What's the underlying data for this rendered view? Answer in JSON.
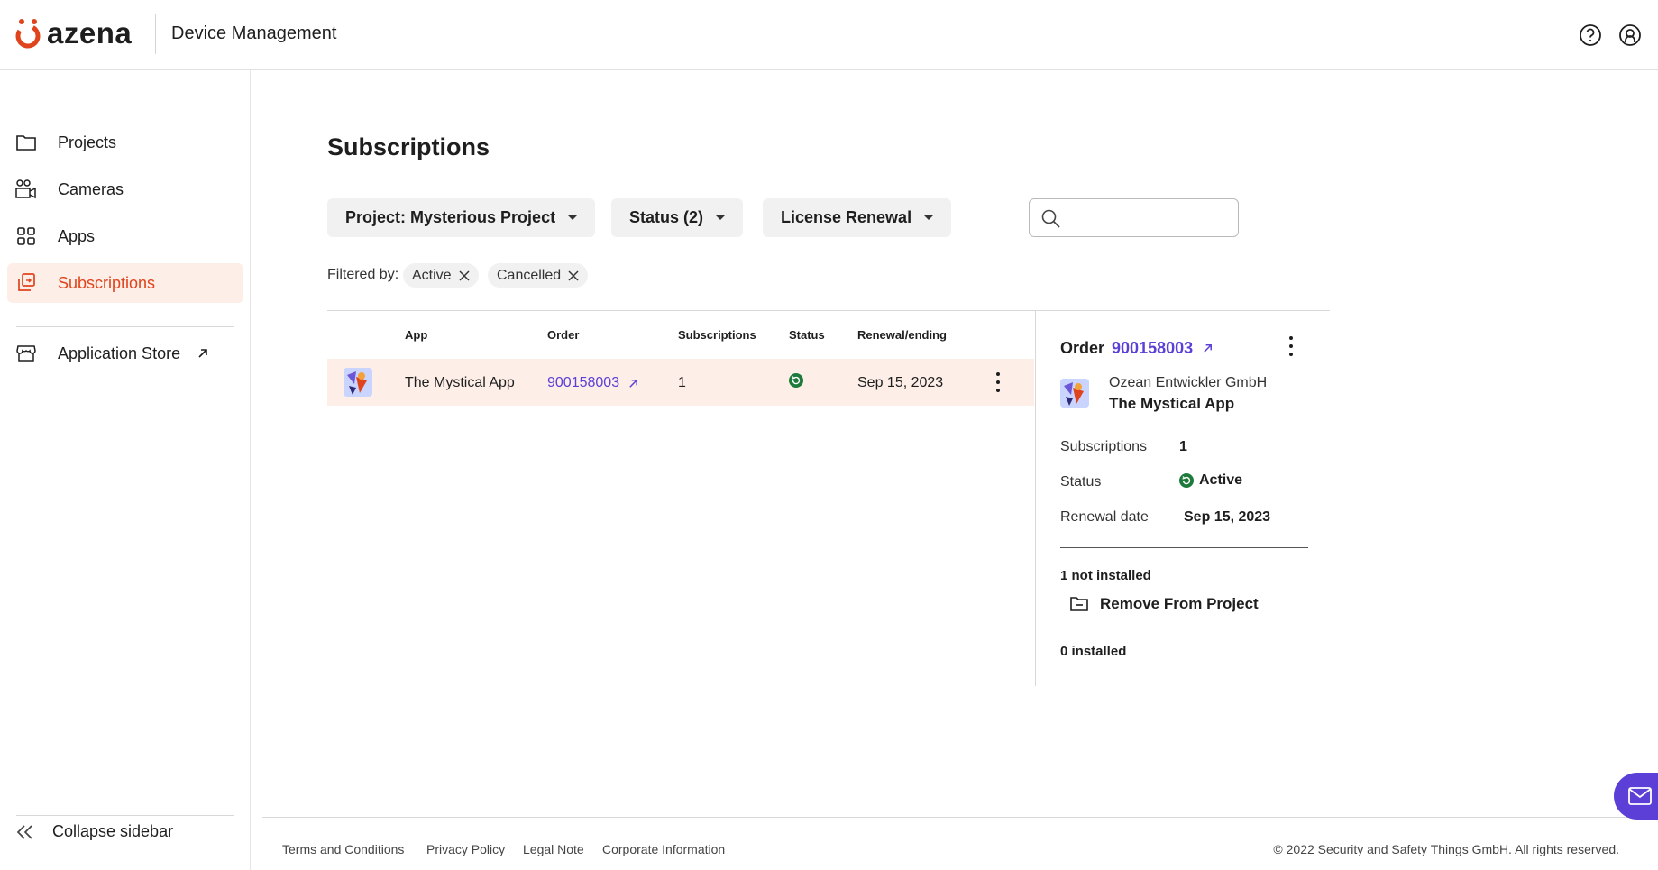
{
  "header": {
    "logo_text": "azena",
    "title": "Device Management",
    "help_icon": "help-circle-icon",
    "account_icon": "user-account-icon",
    "brand_color": "#e0441c"
  },
  "sidebar": {
    "items": [
      {
        "label": "Projects",
        "icon": "folder-icon"
      },
      {
        "label": "Cameras",
        "icon": "camera-icon"
      },
      {
        "label": "Apps",
        "icon": "apps-grid-icon"
      },
      {
        "label": "Subscriptions",
        "icon": "subscriptions-icon",
        "active": true
      },
      {
        "label": "Application Store",
        "icon": "store-icon"
      }
    ],
    "collapse_label": "Collapse sidebar"
  },
  "main": {
    "title": "Subscriptions",
    "filters": {
      "project": "Project: Mysterious Project",
      "status": "Status (2)",
      "renewal": "License Renewal"
    },
    "search": {
      "placeholder": "",
      "value": ""
    },
    "filtered_by_label": "Filtered by:",
    "chips": [
      "Active",
      "Cancelled"
    ],
    "table": {
      "headers": [
        "App",
        "Order",
        "Subscriptions",
        "Status",
        "Renewal/ending"
      ],
      "rows": [
        {
          "app": "The Mystical App",
          "order": "900158003",
          "subscriptions": "1",
          "status": "active",
          "renewal": "Sep 15, 2023"
        }
      ]
    }
  },
  "detail": {
    "order_label": "Order",
    "order_number": "900158003",
    "developer": "Ozean Entwickler GmbH",
    "app_name": "The Mystical App",
    "subscriptions_label": "Subscriptions",
    "subscriptions_value": "1",
    "status_label": "Status",
    "status_value": "Active",
    "renewal_label": "Renewal date",
    "renewal_value": "Sep 15, 2023",
    "not_installed": "1 not installed",
    "remove_action": "Remove From Project",
    "installed": "0 installed",
    "status_color": "#1d7a3a",
    "link_color": "#5b3fd6"
  },
  "footer": {
    "links": [
      "Terms and Conditions",
      "Privacy Policy",
      "Legal Note",
      "Corporate Information"
    ],
    "copyright": "© 2022 Security and Safety Things GmbH. All rights reserved."
  }
}
